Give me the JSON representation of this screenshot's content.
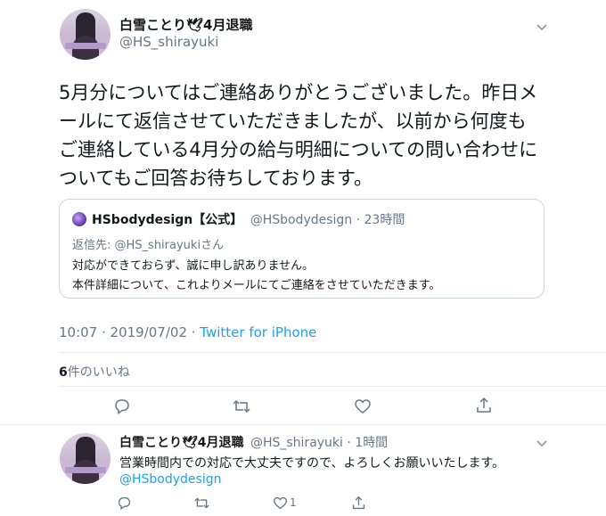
{
  "main_tweet": {
    "display_name": "白雪ことり🕊4月退職",
    "handle": "@HS_shirayuki",
    "text_lines": [
      "5月分についてはご連絡ありがとうございました。昨日メ",
      "ールにて返信させていただきましたが、以前から何度も",
      "ご連絡している4月分の給与明細についての問い合わせに",
      "ついてもご回答お待ちしております。"
    ],
    "quote": {
      "display_name": "HSbodydesign【公式】",
      "handle_time": "@HSbodydesign · 23時間",
      "reply_to_prefix": "返信先: ",
      "reply_to_handle": "@HS_shirayuki",
      "reply_to_suffix": "さん",
      "lines": [
        "対応ができておらず、誠に申し訳ありません。",
        "本件詳細について、これよりメールにてご連絡をさせていただきます。"
      ]
    },
    "timestamp": "10:07 · 2019/07/02 · ",
    "source": "Twitter for iPhone",
    "likes_count": "6",
    "likes_label": "件のいいね"
  },
  "reply_tweet": {
    "display_name": "白雪ことり🕊4月退職",
    "handle_time": "@HS_shirayuki · 1時間",
    "text": "営業時間内での対応で大丈夫ですので、よろしくお願いいたします。",
    "mention": "@HSbodydesign",
    "like_count": "1"
  },
  "icons": [
    "reply-icon",
    "retweet-icon",
    "like-icon",
    "share-icon",
    "chevron-down-icon"
  ],
  "colors": {
    "link": "#1da1f2",
    "secondary": "#657786",
    "divider": "#e6ecf0",
    "icon": "#657786"
  }
}
